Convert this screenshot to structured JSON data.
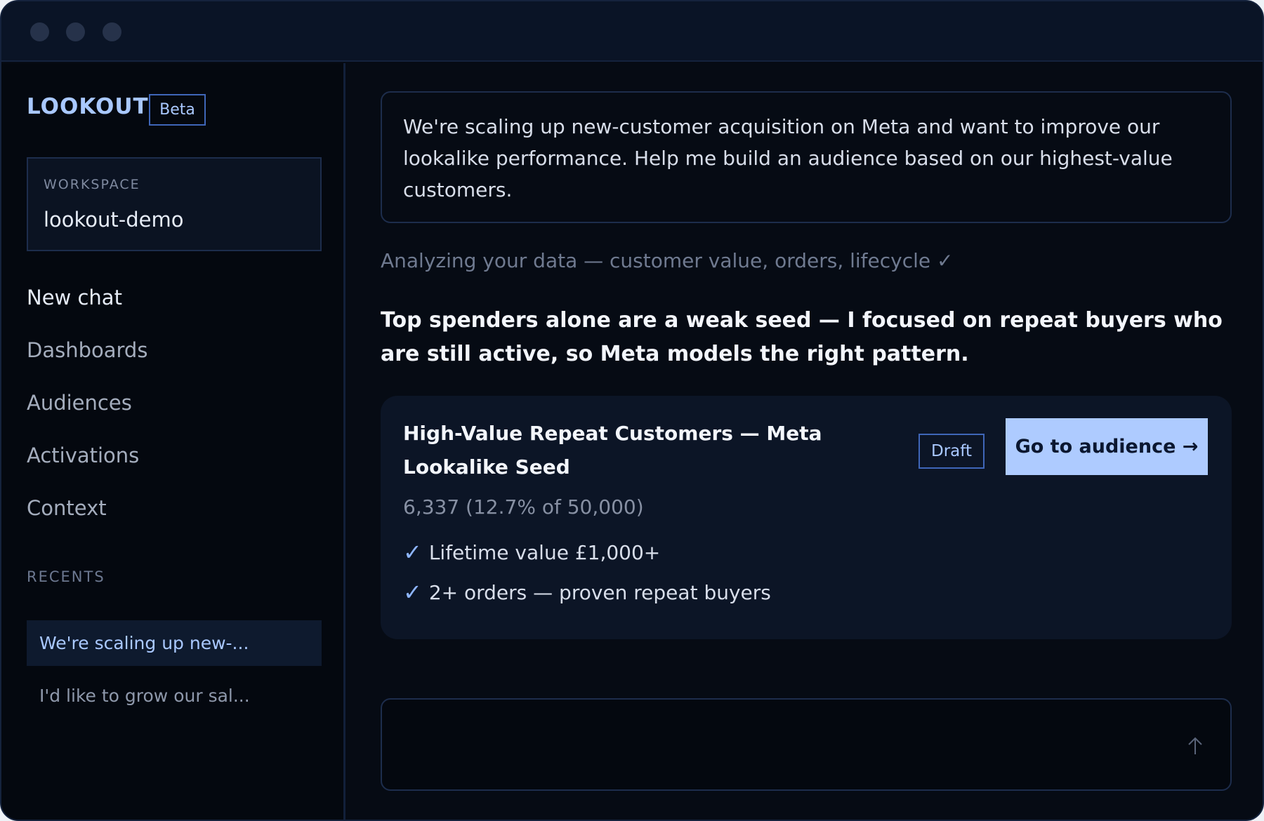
{
  "sidebar": {
    "brand": "LOOKOUT",
    "badge": "Beta",
    "workspace": {
      "label": "WORKSPACE",
      "value": "lookout-demo"
    },
    "nav": [
      "New chat",
      "Dashboards",
      "Audiences",
      "Activations",
      "Context"
    ],
    "recents_label": "RECENTS",
    "recents": [
      "We're scaling up new-...",
      "I'd like to grow our sal..."
    ]
  },
  "main": {
    "prompt": "We're scaling up new-customer acquisition on Meta and want to improve our lookalike performance. Help me build an audience based on our highest-value customers.",
    "status": "Analyzing your data — customer value, orders, lifecycle ✓",
    "answer": "Top spenders alone are a weak seed — I focused on repeat buyers who are still active, so Meta models the right pattern.",
    "card": {
      "title": "High-Value Repeat Customers — Meta Lookalike Seed",
      "badge": "Draft",
      "button": "Go to audience →",
      "count": "6,337 (12.7% of 50,000)",
      "criteria": [
        "Lifetime value £1,000+",
        "2+ orders — proven repeat buyers"
      ]
    },
    "composer": {
      "placeholder": ""
    }
  },
  "icons": {
    "check": "check-icon",
    "send": "arrow-up-icon"
  },
  "colors": {
    "accent": "#aecbff",
    "background": "#060b14"
  }
}
